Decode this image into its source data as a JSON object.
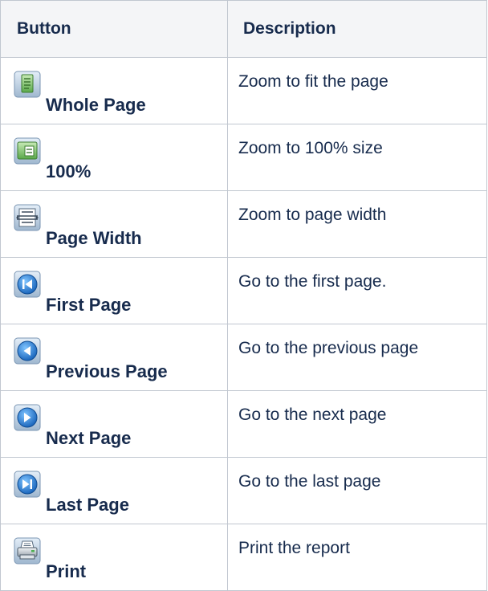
{
  "table": {
    "headers": {
      "button": "Button",
      "description": "Description"
    },
    "rows": [
      {
        "icon": "whole-page-icon",
        "label": "Whole Page",
        "description": "Zoom to fit the page"
      },
      {
        "icon": "zoom-100-icon",
        "label": "100%",
        "description": "Zoom to 100% size"
      },
      {
        "icon": "page-width-icon",
        "label": "Page Width",
        "description": "Zoom to page width"
      },
      {
        "icon": "first-page-icon",
        "label": "First Page",
        "description": "Go to the first page."
      },
      {
        "icon": "previous-page-icon",
        "label": "Previous Page",
        "description": "Go to the previous page"
      },
      {
        "icon": "next-page-icon",
        "label": "Next Page",
        "description": "Go to the next page"
      },
      {
        "icon": "last-page-icon",
        "label": "Last Page",
        "description": "Go to the last page"
      },
      {
        "icon": "print-icon",
        "label": "Print",
        "description": "Print the report"
      }
    ]
  },
  "colors": {
    "border": "#c1c7d0",
    "header_bg": "#f4f5f7",
    "text": "#172b4d",
    "nav_blue": "#1d7fd6",
    "doc_green": "#5cb85c"
  }
}
